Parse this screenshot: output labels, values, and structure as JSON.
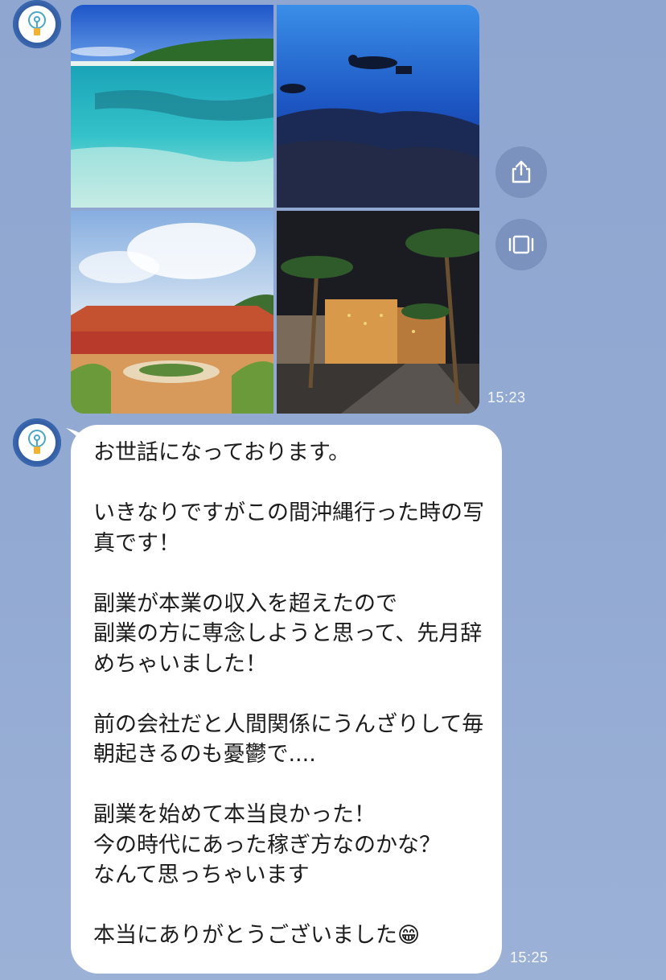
{
  "chat": {
    "image_message": {
      "time": "15:23",
      "images": [
        {
          "subject": "turquoise-sea-beach"
        },
        {
          "subject": "scuba-divers-underwater"
        },
        {
          "subject": "okinawa-museum-building"
        },
        {
          "subject": "palm-trees-night-street"
        }
      ]
    },
    "text_message": {
      "time": "15:25",
      "body": "お世話になっております。\n\nいきなりですがこの間沖縄行った時の写真です！\n\n副業が本業の収入を超えたので\n副業の方に専念しようと思って、先月辞めちゃいました！\n\n前の会社だと人間関係にうんざりして毎朝起きるのも憂鬱で....\n\n副業を始めて本当良かった！\n今の時代にあった稼ぎ方なのかな？\nなんて思っちゃいます\n\n本当にありがとうございました😁"
    },
    "actions": {
      "share_icon": "share-icon",
      "gallery_icon": "gallery-icon"
    }
  },
  "colors": {
    "background": "#93aad3",
    "bubble": "#ffffff",
    "avatar": "#3560a6",
    "action_button": "#7b91be"
  }
}
